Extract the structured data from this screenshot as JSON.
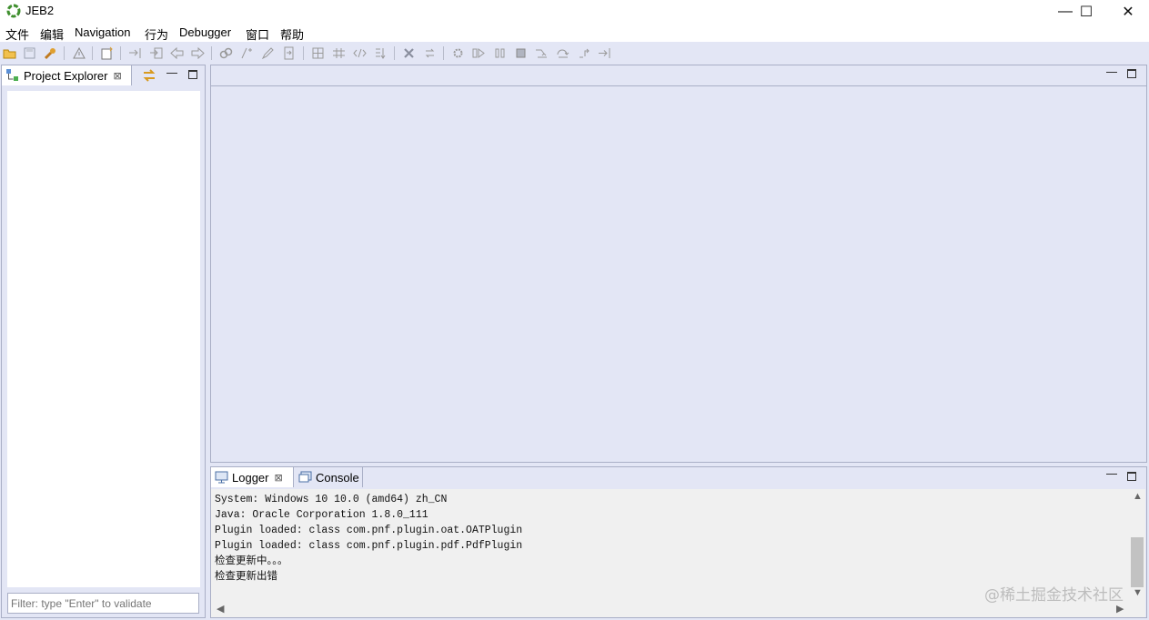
{
  "window": {
    "title": "JEB2",
    "minimize_glyph": "—",
    "maximize_glyph": "☐",
    "close_glyph": "✕"
  },
  "menu": [
    "文件",
    "编辑",
    "Navigation",
    "行为",
    "Debugger",
    "窗口",
    "帮助"
  ],
  "toolbar_icons": [
    "open-folder-icon",
    "save-icon",
    "wrench-icon",
    "warning-icon",
    "new-file-icon",
    "jump-to-icon",
    "export-icon",
    "back-arrow-icon",
    "forward-arrow-icon",
    "link-icon",
    "comment-icon",
    "pencil-icon",
    "rename-icon",
    "grid-icon",
    "grid-alt-icon",
    "code-icon",
    "decompile-icon",
    "delete-icon",
    "refresh-icon",
    "debug-gear-icon",
    "run-icon",
    "pause-icon",
    "stop-icon",
    "step-into-icon",
    "step-over-icon",
    "step-return-icon",
    "run-to-line-icon"
  ],
  "project_explorer": {
    "tab_label": "Project Explorer",
    "close_glyph": "⊠",
    "filter_placeholder": "Filter: type \"Enter\" to validate"
  },
  "bottom_panel": {
    "logger_label": "Logger",
    "console_label": "Console",
    "close_glyph": "⊠",
    "log_lines": [
      "System: Windows 10 10.0 (amd64) zh_CN",
      "Java: Oracle Corporation 1.8.0_111",
      "Plugin loaded: class com.pnf.plugin.oat.OATPlugin",
      "Plugin loaded: class com.pnf.plugin.pdf.PdfPlugin",
      "检查更新中。。。",
      "检查更新出错"
    ]
  },
  "watermark": "@稀土掘金技术社区",
  "colors": {
    "background": "#e3e6f5",
    "border": "#a9afc6",
    "log_background": "#f0f0f0"
  }
}
